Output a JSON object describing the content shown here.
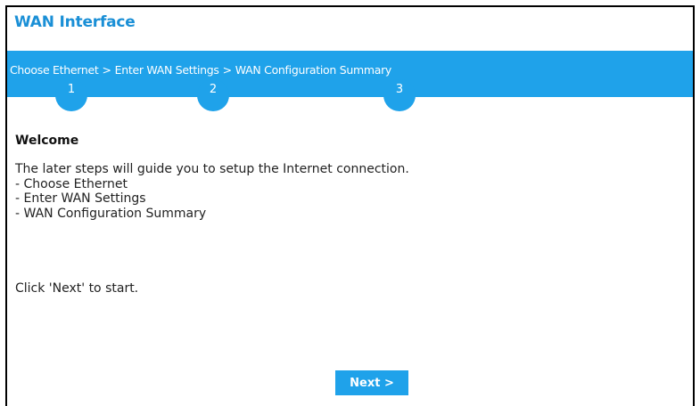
{
  "panel": {
    "title": "WAN Interface"
  },
  "steps": [
    {
      "label": "Choose Ethernet",
      "number": "1"
    },
    {
      "label": "Enter WAN Settings",
      "number": "2"
    },
    {
      "label": "WAN Configuration Summary",
      "number": "3"
    }
  ],
  "step_separator": ">",
  "welcome": {
    "heading": "Welcome",
    "intro": "The later steps will guide you to setup the Internet connection.",
    "items": [
      "- Choose Ethernet",
      "- Enter WAN Settings",
      "- WAN Configuration Summary"
    ],
    "start_hint": "Click 'Next' to start."
  },
  "buttons": {
    "next_label": "Next >"
  },
  "colors": {
    "accent": "#1fa2ea",
    "title": "#1a8fd6"
  }
}
